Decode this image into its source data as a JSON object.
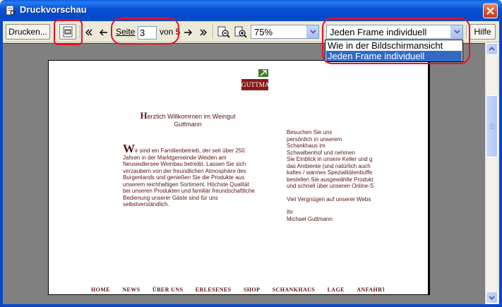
{
  "window": {
    "title": "Druckvorschau"
  },
  "toolbar": {
    "print_label": "Drucken...",
    "page_label": "Seite",
    "page_value": "3",
    "page_of": "von 5",
    "zoom_value": "75%",
    "frame_mode_value": "Jeden Frame individuell",
    "help_label": "Hilfe"
  },
  "dropdown": {
    "options": [
      "Wie in der Bildschirmansicht",
      "Jeden Frame individuell"
    ],
    "selected_index": 1
  },
  "page_content": {
    "logo_text": "GUTTMANN",
    "welcome_title_line1": "erzlich Willkommen im Weingut",
    "welcome_title_initial": "H",
    "welcome_title_line2": "Guttmann",
    "left_initial": "W",
    "left_text": "ir sind ein Familienbetrieb, der seit über 250 Jahren in der Marktgemeinde Weiden am Neusiedlersee Weinbau betreibt. Lassen Sie sich verzaubern von der freundlichen Atmosphäre des Burgenlands und genießen Sie die Produkte aus unserem reichhaltigen Sortiment. Höchste Qualität bei unseren Produkten und familiär freundschaftliche Bedienung unserer Gäste sind für uns selbstverständlich.",
    "right_lines": [
      "Besuchen Sie uns",
      "persönlich in unserem",
      "Schankhaus im",
      "Schwalbenhof und nehmen",
      "Sie Einblick in unsere Keller und g",
      "das Ambiente (und natürlich auch",
      "kaltes / warmes Spezialitätenbuffe",
      "bestellen Sie ausgewählte Produkt",
      "und schnell über unseren Online-S"
    ],
    "right_closing": "Viel Vergnügen auf unserer Webs",
    "right_signoff1": "Ihr",
    "right_signoff2": "Michael Guttmann",
    "nav": [
      "HOME",
      "NEWS",
      "ÜBER UNS",
      "ERLESENES",
      "SHOP",
      "SCHANKHAUS",
      "LAGE",
      "ANFAHRT"
    ]
  },
  "colors": {
    "titlebar": "#0855dd",
    "annotation": "#e8102a",
    "site_text": "#5b1414",
    "logo_band": "#8b1a1a",
    "selection": "#316ac5"
  }
}
